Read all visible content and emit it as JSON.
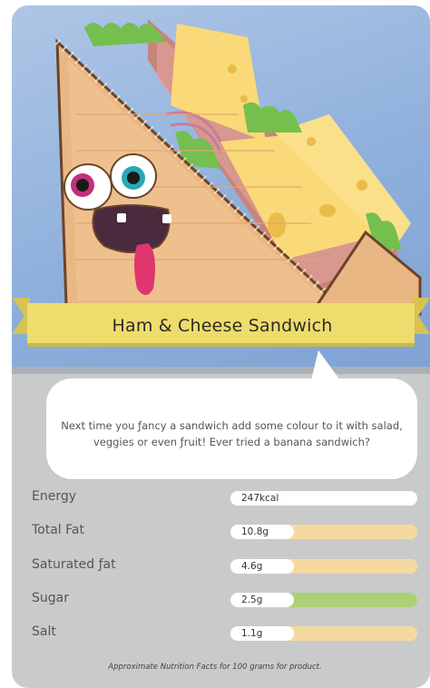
{
  "card": {
    "title": "Ham & Cheese Sandwich",
    "tip": "Next time you ƒancy a sandwich add some colour to it with salad, veggies or even ƒruit! Ever tried a banana sandwich?",
    "footnote": "Approximate Nutrition Facts for 100 grams for product."
  },
  "nutrition": [
    {
      "label": "Energy",
      "value": "247kcal",
      "level": "none",
      "color": "#ffffff"
    },
    {
      "label": "Total Fat",
      "value": "10.8g",
      "level": "medium",
      "color": "#f6d9a0"
    },
    {
      "label": "Saturated ƒat",
      "value": "4.6g",
      "level": "medium",
      "color": "#f6d9a0"
    },
    {
      "label": "Sugar",
      "value": "2.5g",
      "level": "low",
      "color": "#add077"
    },
    {
      "label": "Salt",
      "value": "1.1g",
      "level": "medium",
      "color": "#f6d9a0"
    }
  ],
  "colors": {
    "banner": "#eedd6c",
    "sky": "#9ab7df",
    "panel": "#c9cacb",
    "bread": "#e9b784",
    "cheese": "#f9d978",
    "ham": "#c9847a",
    "lettuce": "#74bf4d"
  }
}
